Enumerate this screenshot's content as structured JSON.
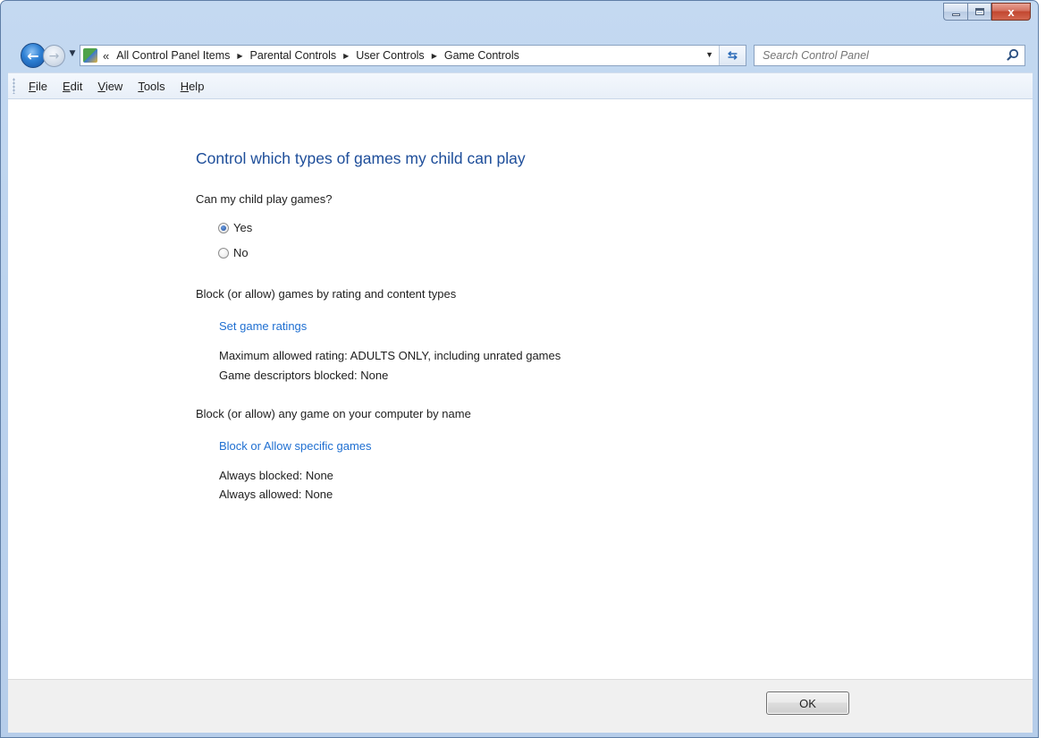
{
  "window": {
    "caption_buttons": {
      "close_glyph": "x"
    }
  },
  "navigation": {
    "back_glyph": "←",
    "forward_glyph": "→",
    "breadcrumb_overflow": "«",
    "breadcrumbs": [
      "All Control Panel Items",
      "Parental Controls",
      "User Controls",
      "Game Controls"
    ],
    "search": {
      "placeholder": "Search Control Panel",
      "value": ""
    }
  },
  "menubar": {
    "items": [
      {
        "underlined": "F",
        "rest": "ile"
      },
      {
        "underlined": "E",
        "rest": "dit"
      },
      {
        "underlined": "V",
        "rest": "iew"
      },
      {
        "underlined": "T",
        "rest": "ools"
      },
      {
        "underlined": "H",
        "rest": "elp"
      }
    ]
  },
  "main": {
    "title": "Control which types of games my child can play",
    "play_question": "Can my child play games?",
    "play_options": [
      {
        "label": "Yes",
        "checked": true
      },
      {
        "label": "No",
        "checked": false
      }
    ],
    "rating_heading": "Block (or allow) games by rating and content types",
    "rating_link": "Set game ratings",
    "rating_details": [
      "Maximum allowed rating:  ADULTS ONLY, including unrated games",
      "Game descriptors blocked:  None"
    ],
    "name_heading": "Block (or allow) any game on your computer by name",
    "name_link": "Block or Allow specific games",
    "name_details": [
      "Always blocked:  None",
      "Always allowed:  None"
    ]
  },
  "footer": {
    "ok_label": "OK"
  },
  "colors": {
    "title": "#1e4e9a",
    "link": "#1f6fd1",
    "frame": "#c4d9f1"
  }
}
